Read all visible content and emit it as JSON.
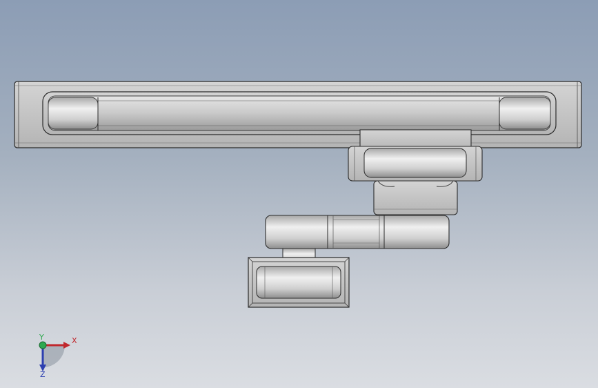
{
  "viewport": {
    "background_top": "#8c9db5",
    "background_bottom": "#dadde2",
    "part_color": "#c8c8c8",
    "edge_color": "#2a2a2a"
  },
  "triad": {
    "x_label": "X",
    "y_label": "Y",
    "z_label": "Z",
    "x_color": "#c0282d",
    "y_color": "#2fa84f",
    "z_color": "#2c3fb0"
  }
}
